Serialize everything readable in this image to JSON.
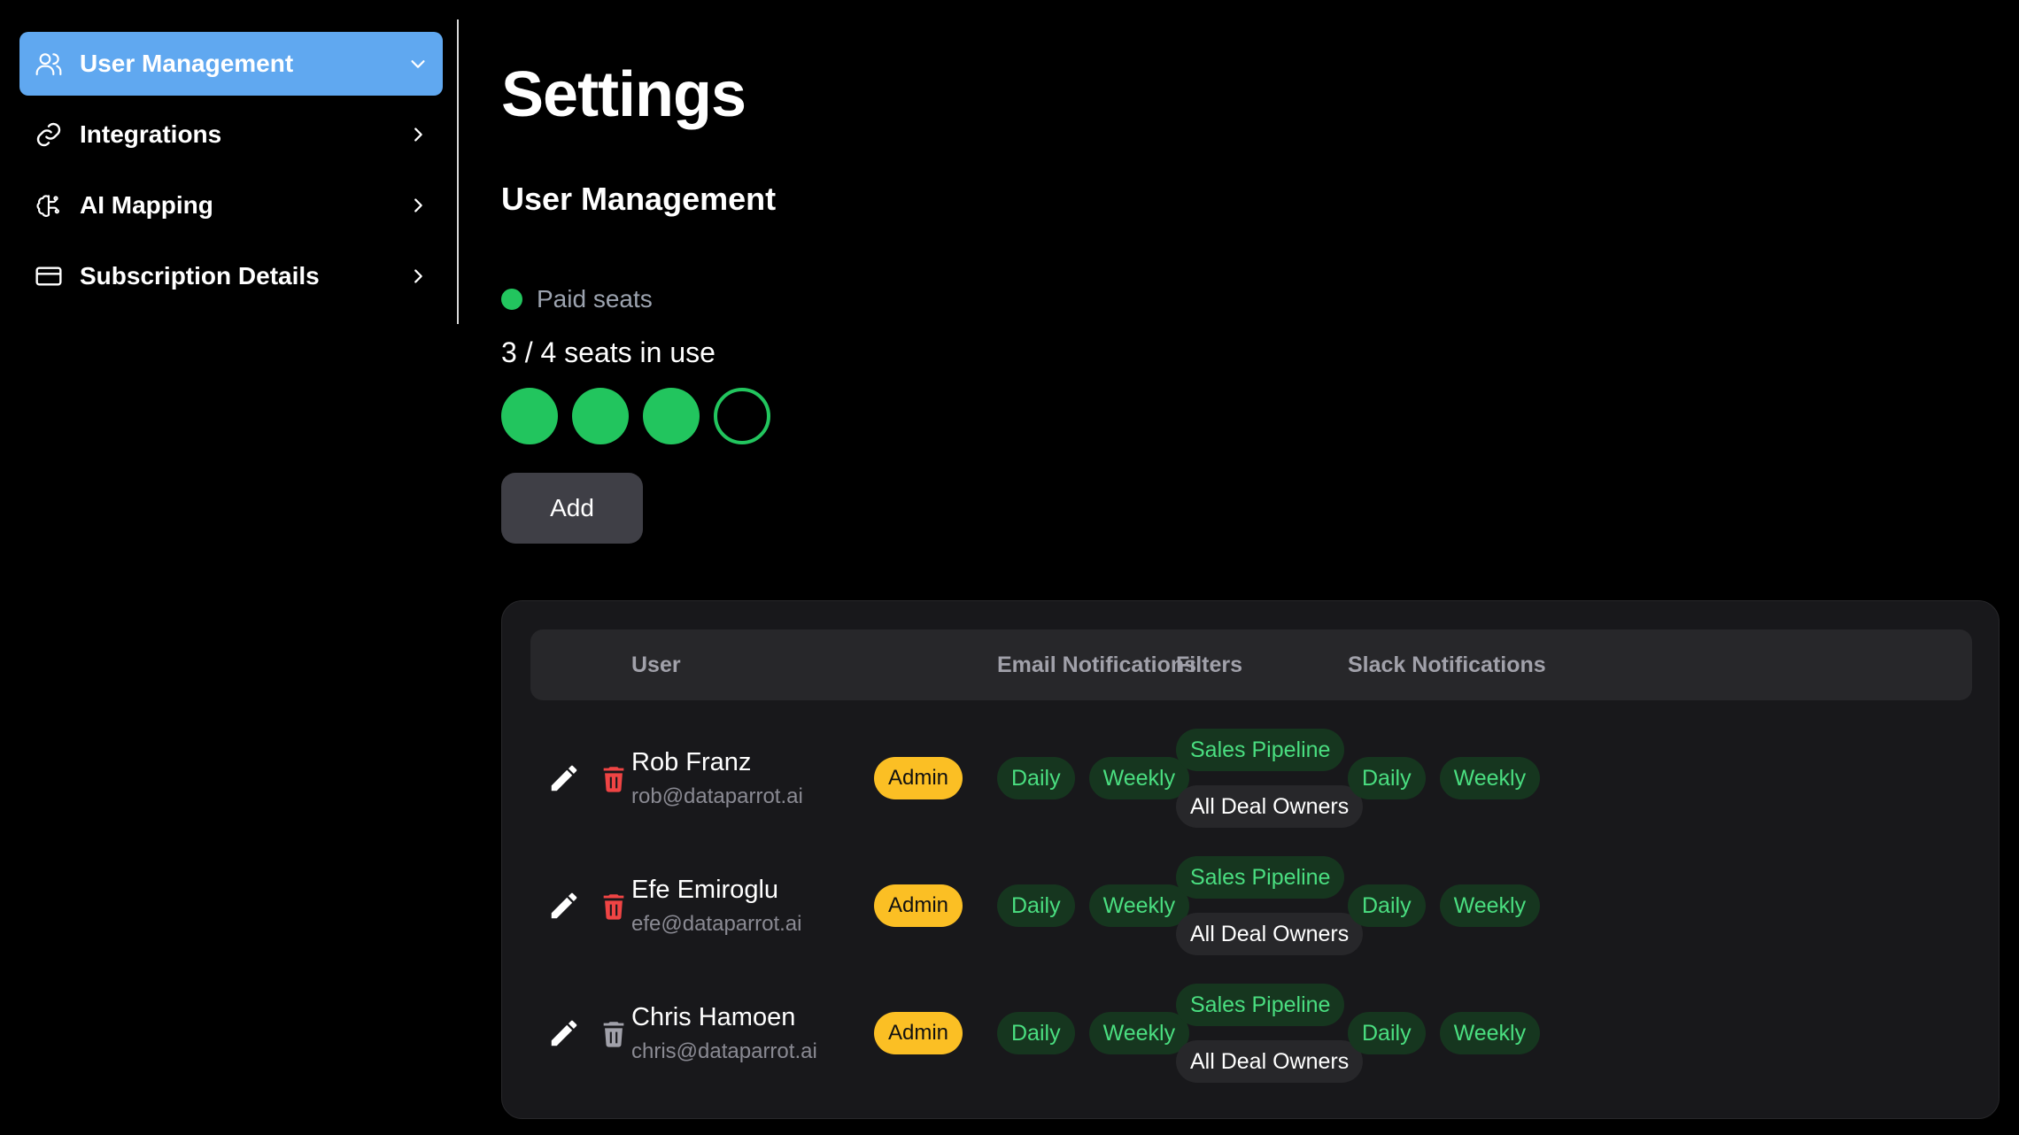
{
  "sidebar": {
    "items": [
      {
        "label": "User Management",
        "icon": "users-icon",
        "expanded": true
      },
      {
        "label": "Integrations",
        "icon": "link-icon"
      },
      {
        "label": "AI Mapping",
        "icon": "brain-icon"
      },
      {
        "label": "Subscription Details",
        "icon": "credit-card-icon"
      }
    ]
  },
  "page": {
    "title": "Settings",
    "section_title": "User Management"
  },
  "seats": {
    "legend_label": "Paid seats",
    "usage_text": "3 / 4 seats in use",
    "used": 3,
    "total": 4,
    "add_label": "Add"
  },
  "table": {
    "headers": {
      "user": "User",
      "email_notifications": "Email Notifications",
      "filters": "Filters",
      "slack_notifications": "Slack Notifications"
    },
    "rows": [
      {
        "name": "Rob Franz",
        "email": "rob@dataparrot.ai",
        "role": "Admin",
        "email_notifications": [
          "Daily",
          "Weekly"
        ],
        "filters": [
          "Sales Pipeline",
          "All Deal Owners"
        ],
        "slack_notifications": [
          "Daily",
          "Weekly"
        ],
        "delete_enabled": true
      },
      {
        "name": "Efe Emiroglu",
        "email": "efe@dataparrot.ai",
        "role": "Admin",
        "email_notifications": [
          "Daily",
          "Weekly"
        ],
        "filters": [
          "Sales Pipeline",
          "All Deal Owners"
        ],
        "slack_notifications": [
          "Daily",
          "Weekly"
        ],
        "delete_enabled": true
      },
      {
        "name": "Chris Hamoen",
        "email": "chris@dataparrot.ai",
        "role": "Admin",
        "email_notifications": [
          "Daily",
          "Weekly"
        ],
        "filters": [
          "Sales Pipeline",
          "All Deal Owners"
        ],
        "slack_notifications": [
          "Daily",
          "Weekly"
        ],
        "delete_enabled": false
      }
    ]
  },
  "colors": {
    "accent": "#60a8f0",
    "green": "#22c55e",
    "admin_badge": "#fbbf24",
    "delete_red": "#ef4444",
    "delete_disabled": "#a1a1aa"
  }
}
